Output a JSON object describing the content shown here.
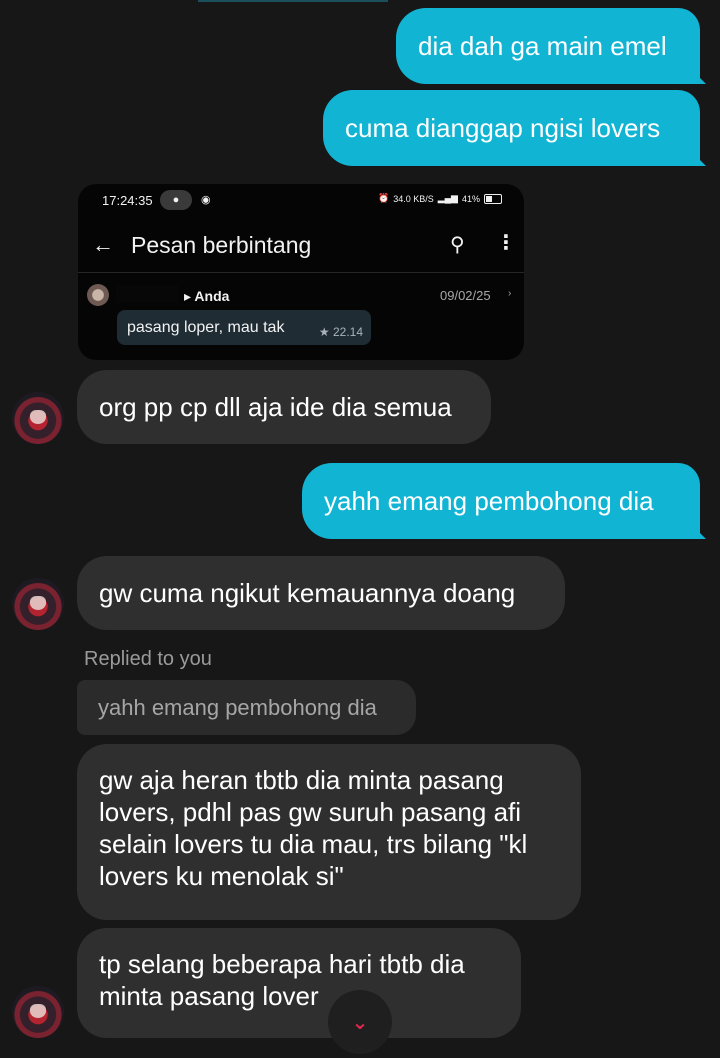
{
  "messages": {
    "sent_1": "dia dah ga main emel",
    "sent_2": "cuma dianggap ngisi lovers",
    "recv_1": "org pp cp dll aja ide dia semua",
    "sent_3": "yahh emang pembohong dia",
    "recv_2": "gw cuma ngikut kemauannya doang",
    "reply_label": "Replied to you",
    "reply_quote": "yahh emang pembohong dia",
    "recv_3_lines": [
      "gw aja heran tbtb dia minta pasang",
      "lovers, pdhl pas gw suruh pasang afi",
      "selain lovers tu dia mau, trs bilang \"kl",
      "lovers ku menolak si\""
    ],
    "recv_4_lines": [
      "tp selang beberapa hari tbtb dia",
      "minta pasang lover"
    ]
  },
  "embedded_screenshot": {
    "status_time": "17:24:35",
    "status_right": "34.0 KB/S",
    "battery": "41%",
    "title": "Pesan berbintang",
    "sender": "Anda",
    "date": "09/02/25",
    "message": "pasang loper, mau tak",
    "message_time": "★ 22.14"
  },
  "icons": {
    "back": "←",
    "search": "⚲",
    "menu": "⋮",
    "scroll_down": "⌄"
  },
  "colors": {
    "sent_bubble": "#12b4d4",
    "received_bubble": "#2f2f2f",
    "background": "#171717",
    "scroll_icon": "#e0274d"
  }
}
